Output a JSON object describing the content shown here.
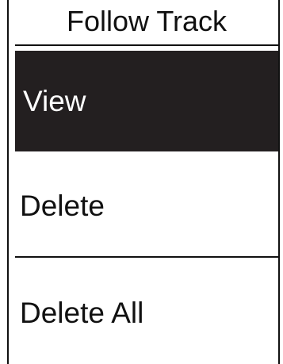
{
  "header": {
    "title": "Follow Track"
  },
  "menu": {
    "items": [
      {
        "label": "View",
        "selected": true
      },
      {
        "label": "Delete",
        "selected": false
      },
      {
        "label": "Delete All",
        "selected": false
      }
    ]
  },
  "colors": {
    "background": "#ffffff",
    "foreground": "#111111",
    "selection": "#231f20",
    "selection_text": "#ffffff"
  }
}
